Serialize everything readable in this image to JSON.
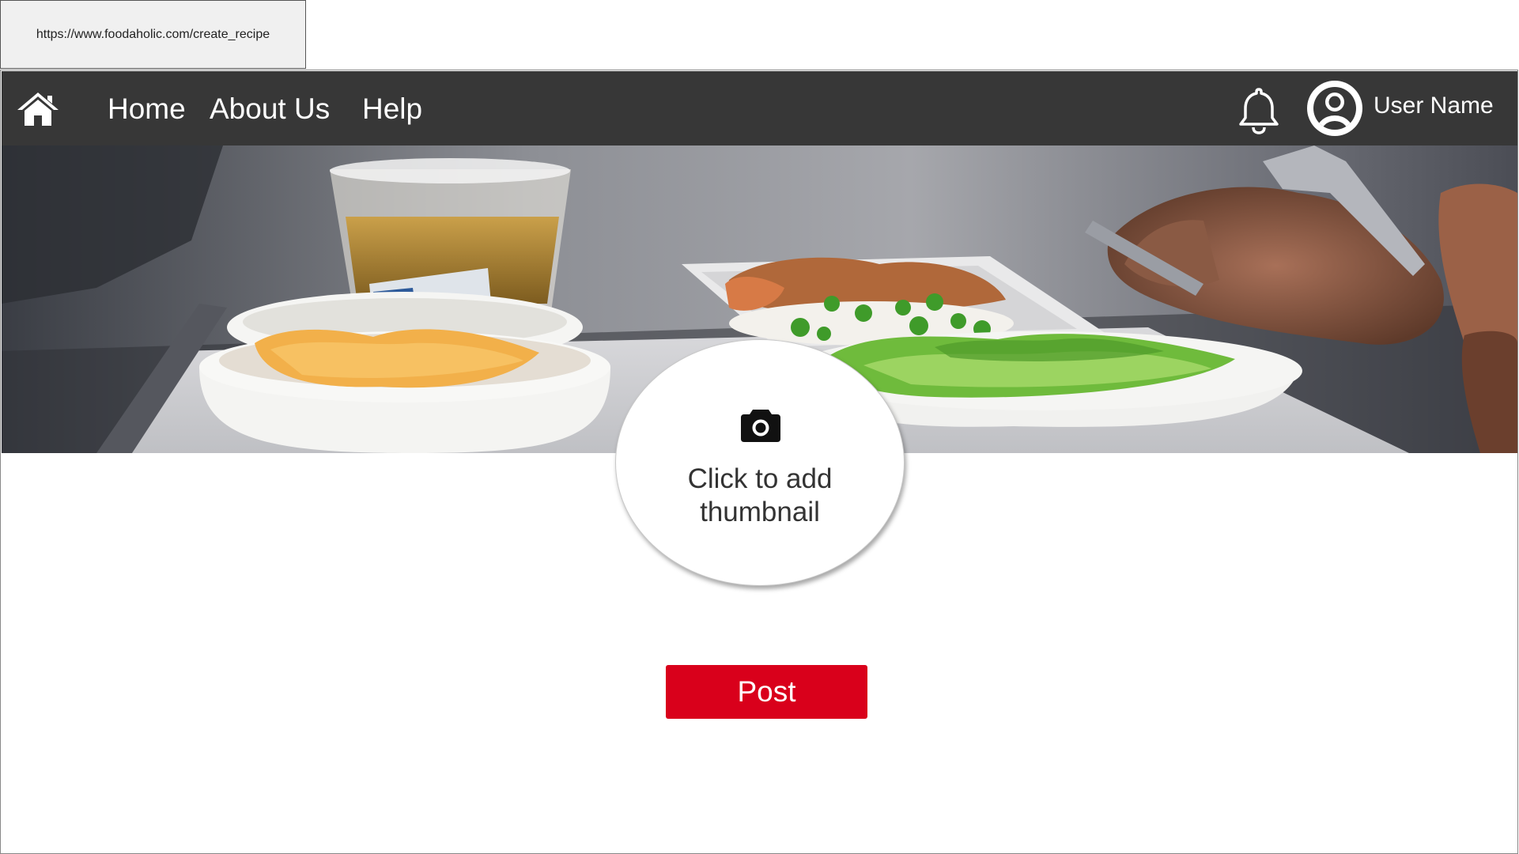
{
  "browser": {
    "url": "https://www.foodaholic.com/create_recipe"
  },
  "navbar": {
    "home_icon": "home-icon",
    "links": [
      {
        "label": "Home"
      },
      {
        "label": "About Us"
      },
      {
        "label": "Help"
      }
    ],
    "notification_icon": "bell-icon",
    "avatar_icon": "user-circle-icon",
    "user_name": "User Name",
    "background_color": "#373737"
  },
  "banner": {
    "image": "food-tray-photo"
  },
  "thumbnail": {
    "icon": "camera-icon",
    "label": "Click to add thumbnail"
  },
  "actions": {
    "post_label": "Post",
    "post_color": "#d9001b"
  }
}
